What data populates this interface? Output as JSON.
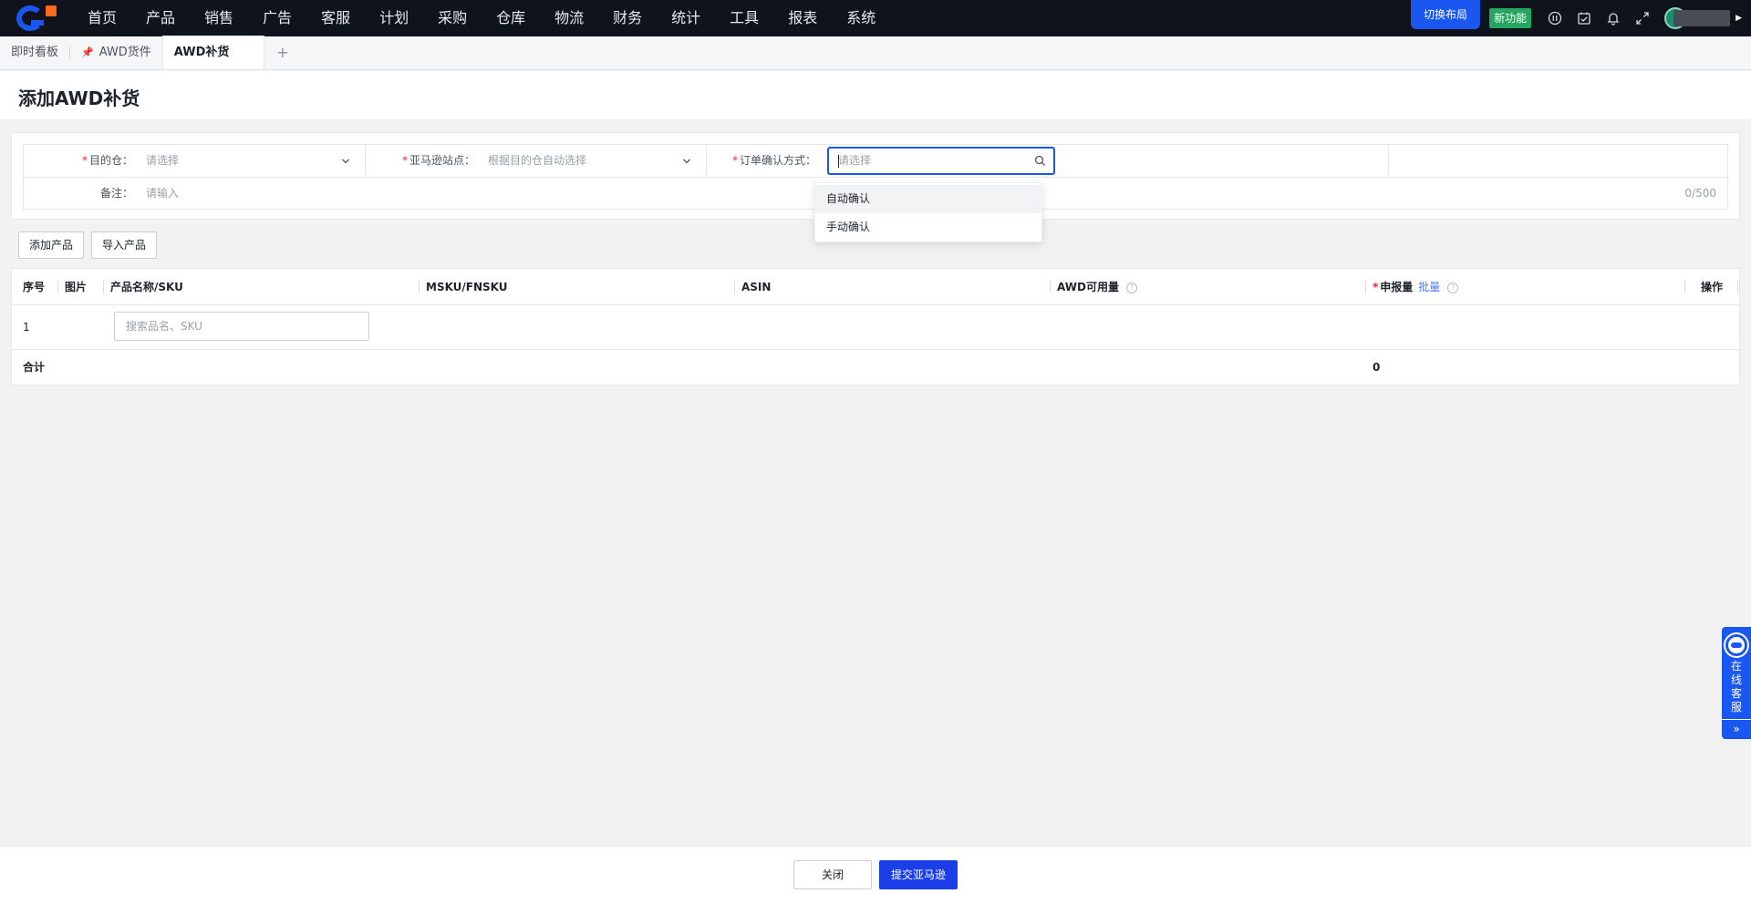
{
  "nav": {
    "items": [
      "首页",
      "产品",
      "销售",
      "广告",
      "客服",
      "计划",
      "采购",
      "仓库",
      "物流",
      "财务",
      "统计",
      "工具",
      "报表",
      "系统"
    ],
    "switch_layout": "切换布局",
    "new_feature": "新功能"
  },
  "tabs": {
    "items": [
      {
        "label": "即时看板"
      },
      {
        "label": "AWD货件",
        "pinned": true
      },
      {
        "label": "AWD补货",
        "active": true
      }
    ],
    "add": "+"
  },
  "page": {
    "title": "添加AWD补货"
  },
  "form": {
    "destination": {
      "label": "目的仓：",
      "placeholder": "请选择"
    },
    "amazon_site": {
      "label": "亚马逊站点：",
      "placeholder": "根据目的仓自动选择"
    },
    "confirm_method": {
      "label": "订单确认方式：",
      "placeholder": "请选择",
      "options": [
        "自动确认",
        "手动确认"
      ]
    },
    "remark": {
      "label": "备注：",
      "placeholder": "请输入",
      "counter": "0/500"
    }
  },
  "actions": {
    "add_product": "添加产品",
    "import_product": "导入产品"
  },
  "table": {
    "columns": {
      "index": "序号",
      "image": "图片",
      "name": "产品名称/SKU",
      "msku": "MSKU/FNSKU",
      "asin": "ASIN",
      "awd": "AWD可用量",
      "declare": "申报量",
      "batch": "批量",
      "op": "操作"
    },
    "rows": [
      {
        "index": "1",
        "search_placeholder": "搜索品名、SKU"
      }
    ],
    "footer": {
      "label": "合计",
      "declare_total": "0"
    }
  },
  "bottom": {
    "close": "关闭",
    "submit": "提交亚马逊"
  },
  "service": {
    "label": "在线客服",
    "arrow": "»"
  },
  "colors": {
    "accent": "#1a56f0",
    "new_feature": "#25a55f",
    "required": "#f5222d",
    "topbar": "#0f131c"
  }
}
